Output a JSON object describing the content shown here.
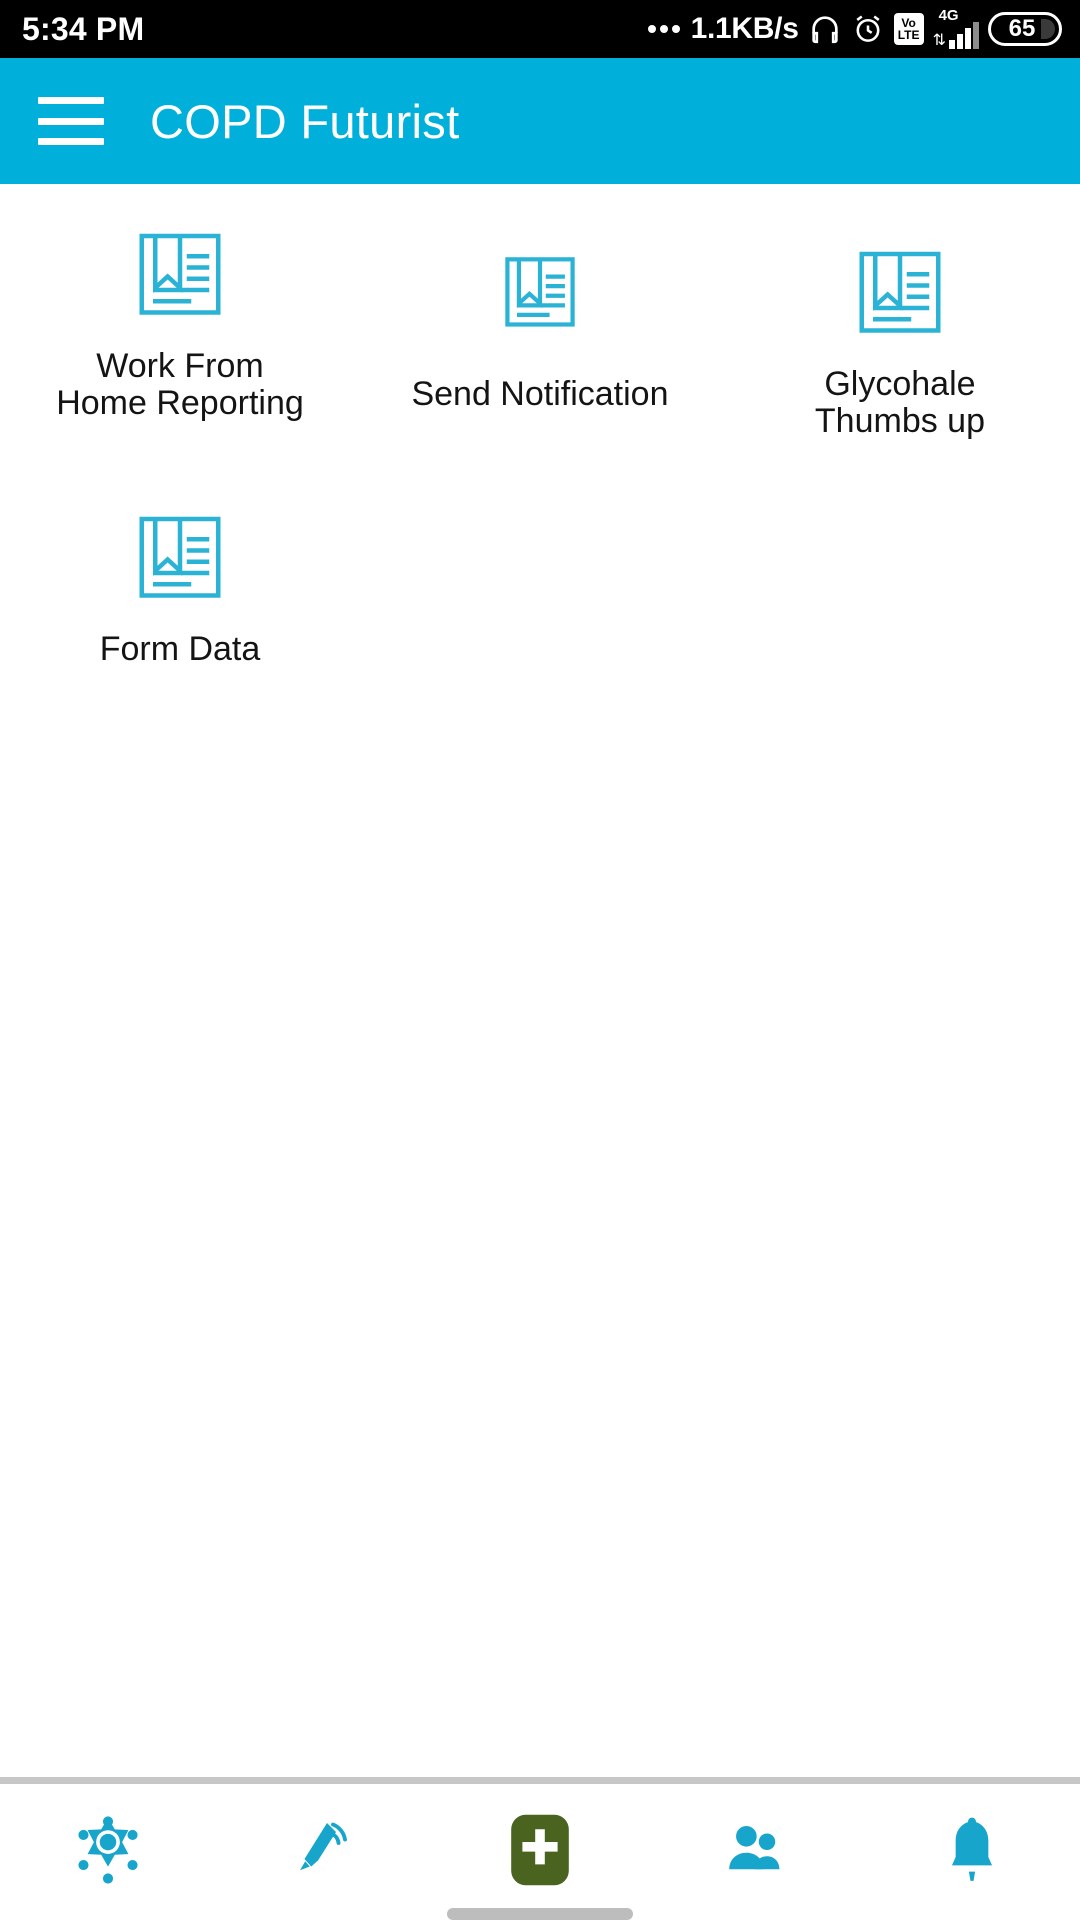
{
  "status_bar": {
    "clock": "5:34 PM",
    "network_speed": "1.1KB/s",
    "volte_top": "Vo",
    "volte_bottom": "LTE",
    "network_type": "4G",
    "battery_level": "65",
    "icons": [
      "more-dots-icon",
      "headphones-icon",
      "alarm-clock-icon",
      "volte-icon",
      "signal-bars-icon",
      "battery-icon"
    ],
    "background_color": "#000000",
    "text_color": "#ffffff"
  },
  "app_bar": {
    "title": "COPD Futurist",
    "menu_icon": "hamburger-menu-icon",
    "background_color": "#00b0da",
    "text_color": "#ffffff"
  },
  "grid": {
    "icon_color": "#2bb3d6",
    "items": [
      {
        "label": "Work From\nHome Reporting",
        "icon": "document-bookmark-icon"
      },
      {
        "label": "Send Notification",
        "icon": "document-bookmark-icon"
      },
      {
        "label": "Glycohale\nThumbs up",
        "icon": "document-bookmark-icon"
      },
      {
        "label": "Form Data",
        "icon": "document-bookmark-icon"
      }
    ]
  },
  "bottom_nav": {
    "accent_color": "#18a5cc",
    "add_button_color": "#4a6420",
    "items": [
      {
        "name": "badge-star-icon",
        "label": ""
      },
      {
        "name": "megaphone-icon",
        "label": ""
      },
      {
        "name": "add-plus-icon",
        "label": ""
      },
      {
        "name": "people-icon",
        "label": ""
      },
      {
        "name": "bell-icon",
        "label": ""
      }
    ]
  }
}
